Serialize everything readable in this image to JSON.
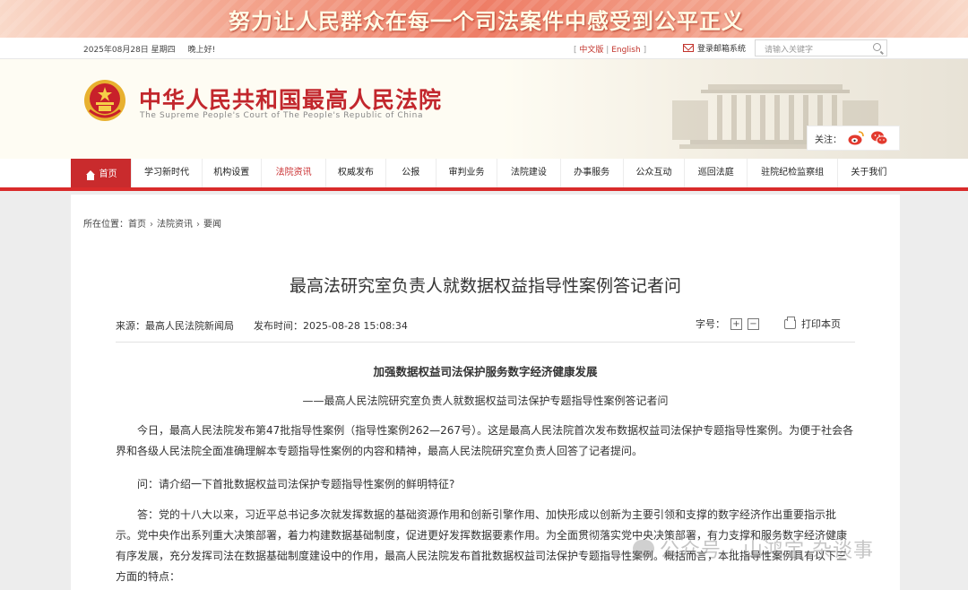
{
  "banner": {
    "slogan": "努力让人民群众在每一个司法案件中感受到公平正义"
  },
  "topbar": {
    "date": "2025年08月28日 星期四",
    "greeting": "晚上好!",
    "lang_cn": "中文版",
    "lang_en": "English",
    "mail_label": "登录邮箱系统",
    "search_placeholder": "请输入关键字"
  },
  "header": {
    "title_cn": "中华人民共和国最高人民法院",
    "title_en": "The Supreme People's Court of The People's Republic of China",
    "follow_label": "关注："
  },
  "nav": {
    "items": [
      "首页",
      "学习新时代",
      "机构设置",
      "法院资讯",
      "权威发布",
      "公报",
      "审判业务",
      "法院建设",
      "办事服务",
      "公众互动",
      "巡回法庭",
      "驻院纪检监察组",
      "关于我们"
    ]
  },
  "breadcrumb": {
    "prefix": "所在位置：",
    "items": [
      "首页",
      "法院资讯",
      "要闻"
    ]
  },
  "article": {
    "title": "最高法研究室负责人就数据权益指导性案例答记者问",
    "source": "来源：最高人民法院新闻局",
    "published": "发布时间：2025-08-28 15:08:34",
    "font_size_label": "字号：",
    "zoom_in": "+",
    "zoom_out": "−",
    "print_label": "打印本页",
    "subhead": "加强数据权益司法保护服务数字经济健康发展",
    "subline": "——最高人民法院研究室负责人就数据权益司法保护专题指导性案例答记者问",
    "para1": "今日，最高人民法院发布第47批指导性案例（指导性案例262—267号）。这是最高人民法院首次发布数据权益司法保护专题指导性案例。为便于社会各界和各级人民法院全面准确理解本专题指导性案例的内容和精神，最高人民法院研究室负责人回答了记者提问。",
    "q1": "问：请介绍一下首批数据权益司法保护专题指导性案例的鲜明特征?",
    "a1": "答：党的十八大以来，习近平总书记多次就发挥数据的基础资源作用和创新引擎作用、加快形成以创新为主要引领和支撑的数字经济作出重要指示批示。党中央作出系列重大决策部署，着力构建数据基础制度，促进更好发挥数据要素作用。为全面贯彻落实党中央决策部署，有力支撑和服务数字经济健康有序发展，充分发挥司法在数据基础制度建设中的作用，最高人民法院发布首批数据权益司法保护专题指导性案例。概括而言，本批指导性案例具有以下三方面的特点："
  },
  "watermark": {
    "text": "公众号 · 山鸿宇 杂谈事"
  },
  "colors": {
    "brand_red": "#c92b2d",
    "nav_bar": "#d92b2b"
  }
}
